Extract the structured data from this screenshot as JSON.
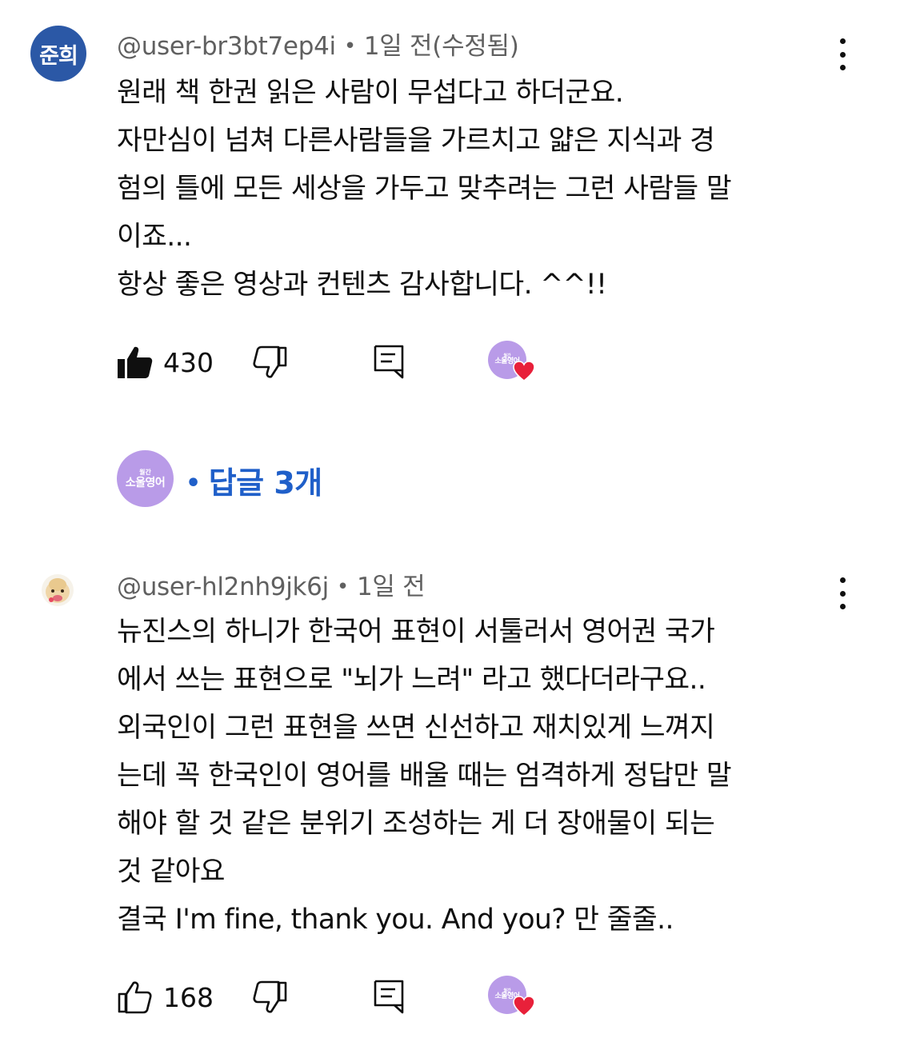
{
  "comments": [
    {
      "avatar_text": "준희",
      "username": "@user-br3bt7ep4i",
      "time": "1일 전(수정됨)",
      "lines": [
        "원래 책 한권 읽은 사람이 무섭다고 하더군요.",
        "자만심이 넘쳐 다른사람들을 가르치고 얇은 지식과 경",
        "험의 틀에 모든 세상을 가두고 맞추려는 그런 사람들 말",
        "이죠...",
        "항상 좋은 영상과 컨텐츠 감사합니다. ^^!!"
      ],
      "likes": "430",
      "liked": true
    },
    {
      "username": "@user-hl2nh9jk6j",
      "time": "1일 전",
      "lines": [
        "뉴진스의 하니가 한국어 표현이 서툴러서 영어권 국가",
        "에서 쓰는 표현으로 \"뇌가 느려\" 라고 했다더라구요..",
        "외국인이 그런 표현을 쓰면 신선하고 재치있게 느껴지",
        "는데 꼭 한국인이 영어를 배울 때는 엄격하게 정답만 말",
        "해야 할 것 같은 분위기 조성하는 게 더 장애물이 되는",
        "것 같아요",
        "결국 I'm fine, thank you. And you? 만 줄줄.."
      ],
      "likes": "168",
      "liked": false
    }
  ],
  "creator_badge": {
    "line1": "월간",
    "line2": "소울영어"
  },
  "replies_label": "답글 3개",
  "colors": {
    "avatar_blue": "#2b58a6",
    "creator_purple": "#b99be8",
    "link_blue": "#1f5fc9",
    "heart_red": "#e8203a",
    "meta_gray": "#606060"
  },
  "icons": [
    "thumbs-up-icon",
    "thumbs-down-icon",
    "reply-icon",
    "more-vertical-icon",
    "heart-icon"
  ]
}
